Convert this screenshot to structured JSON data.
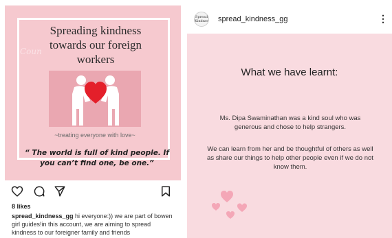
{
  "post1": {
    "image": {
      "ghost_text": "Coun",
      "title_lines": [
        "Spreading kindness",
        "towards our foreign",
        "workers"
      ],
      "subtitle": "~treating everyone with love~",
      "quote_lines": [
        "“ The world is full of kind people. If",
        "you can’t find one, be one.”"
      ]
    },
    "actions": {
      "like": "heart-outline-icon",
      "comment": "comment-icon",
      "share": "paper-plane-icon",
      "save": "bookmark-icon"
    },
    "likes": "8 likes",
    "caption": {
      "username": "spread_kindness_gg",
      "text": " hi everyone:)) we are part of bowen girl guides!in this account, we are aiming to spread kindness to our foreigner family and friends"
    }
  },
  "post2": {
    "header": {
      "avatar_text": "Spread Kindness",
      "username": "spread_kindness_gg",
      "more_icon": "more-vertical-icon",
      "more_glyph": "⋮"
    },
    "slide": {
      "title": "What we have learnt:",
      "paragraph1": "Ms. Dipa Swaminathan was a kind soul who was generous and chose to help strangers.",
      "paragraph2": "We can learn from her and be thoughtful of others as well as share our things to help other people even if we do not know them."
    }
  },
  "colors": {
    "post_background": "#f6c9cf",
    "slide_background": "#f9dbe0",
    "heart_red": "#e41f2a",
    "heart_pink": "#f4a7b7"
  }
}
